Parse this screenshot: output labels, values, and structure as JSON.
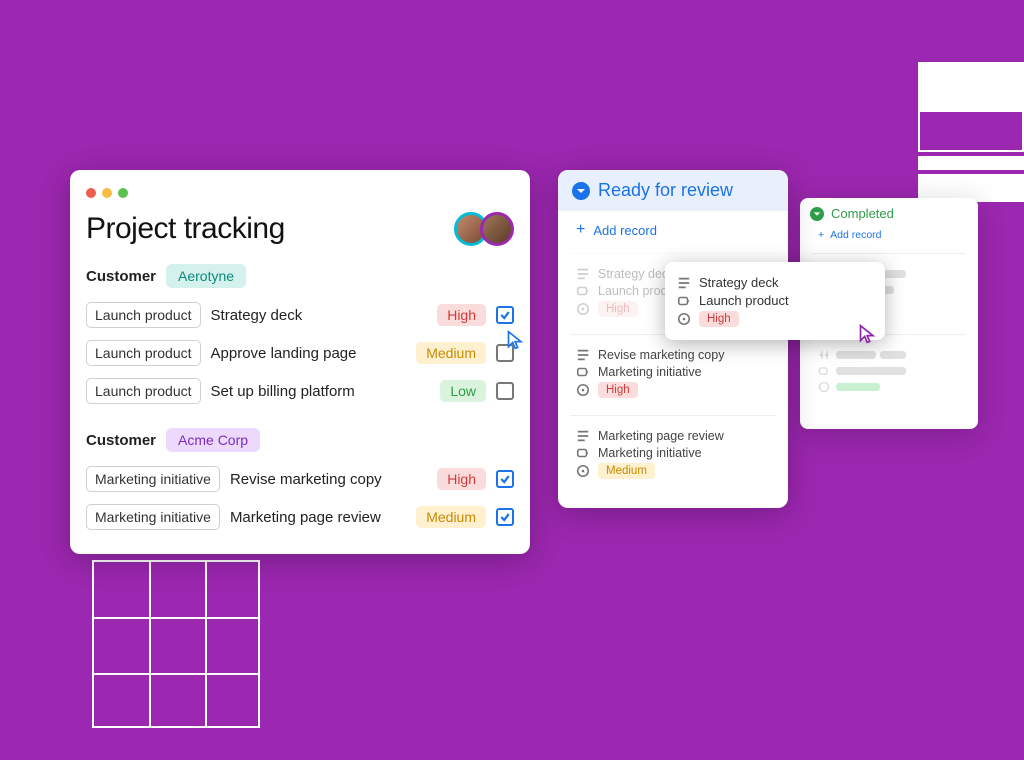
{
  "main": {
    "title": "Project tracking",
    "groups": [
      {
        "label": "Customer",
        "customer": "Aerotyne",
        "chipClass": "teal",
        "rows": [
          {
            "project": "Launch product",
            "task": "Strategy deck",
            "priority": "High",
            "priClass": "high",
            "checked": true
          },
          {
            "project": "Launch product",
            "task": "Approve landing page",
            "priority": "Medium",
            "priClass": "med",
            "checked": false
          },
          {
            "project": "Launch product",
            "task": "Set up billing platform",
            "priority": "Low",
            "priClass": "low",
            "checked": false
          }
        ]
      },
      {
        "label": "Customer",
        "customer": "Acme Corp",
        "chipClass": "purple",
        "rows": [
          {
            "project": "Marketing initiative",
            "task": "Revise marketing copy",
            "priority": "High",
            "priClass": "high",
            "checked": true
          },
          {
            "project": "Marketing initiative",
            "task": "Marketing page review",
            "priority": "Medium",
            "priClass": "med",
            "checked": true
          }
        ]
      }
    ]
  },
  "review": {
    "title": "Ready for review",
    "add": "Add record",
    "items": [
      {
        "title": "Strategy deck",
        "project": "Launch product",
        "priority": "High",
        "priClass": "high",
        "dim": true
      },
      {
        "title": "Revise marketing copy",
        "project": "Marketing initiative",
        "priority": "High",
        "priClass": "high",
        "dim": false
      },
      {
        "title": "Marketing page review",
        "project": "Marketing initiative",
        "priority": "Medium",
        "priClass": "med",
        "dim": false
      }
    ]
  },
  "popup": {
    "title": "Strategy deck",
    "project": "Launch product",
    "priority": "High",
    "priClass": "high"
  },
  "completed": {
    "title": "Completed",
    "add": "Add record"
  }
}
